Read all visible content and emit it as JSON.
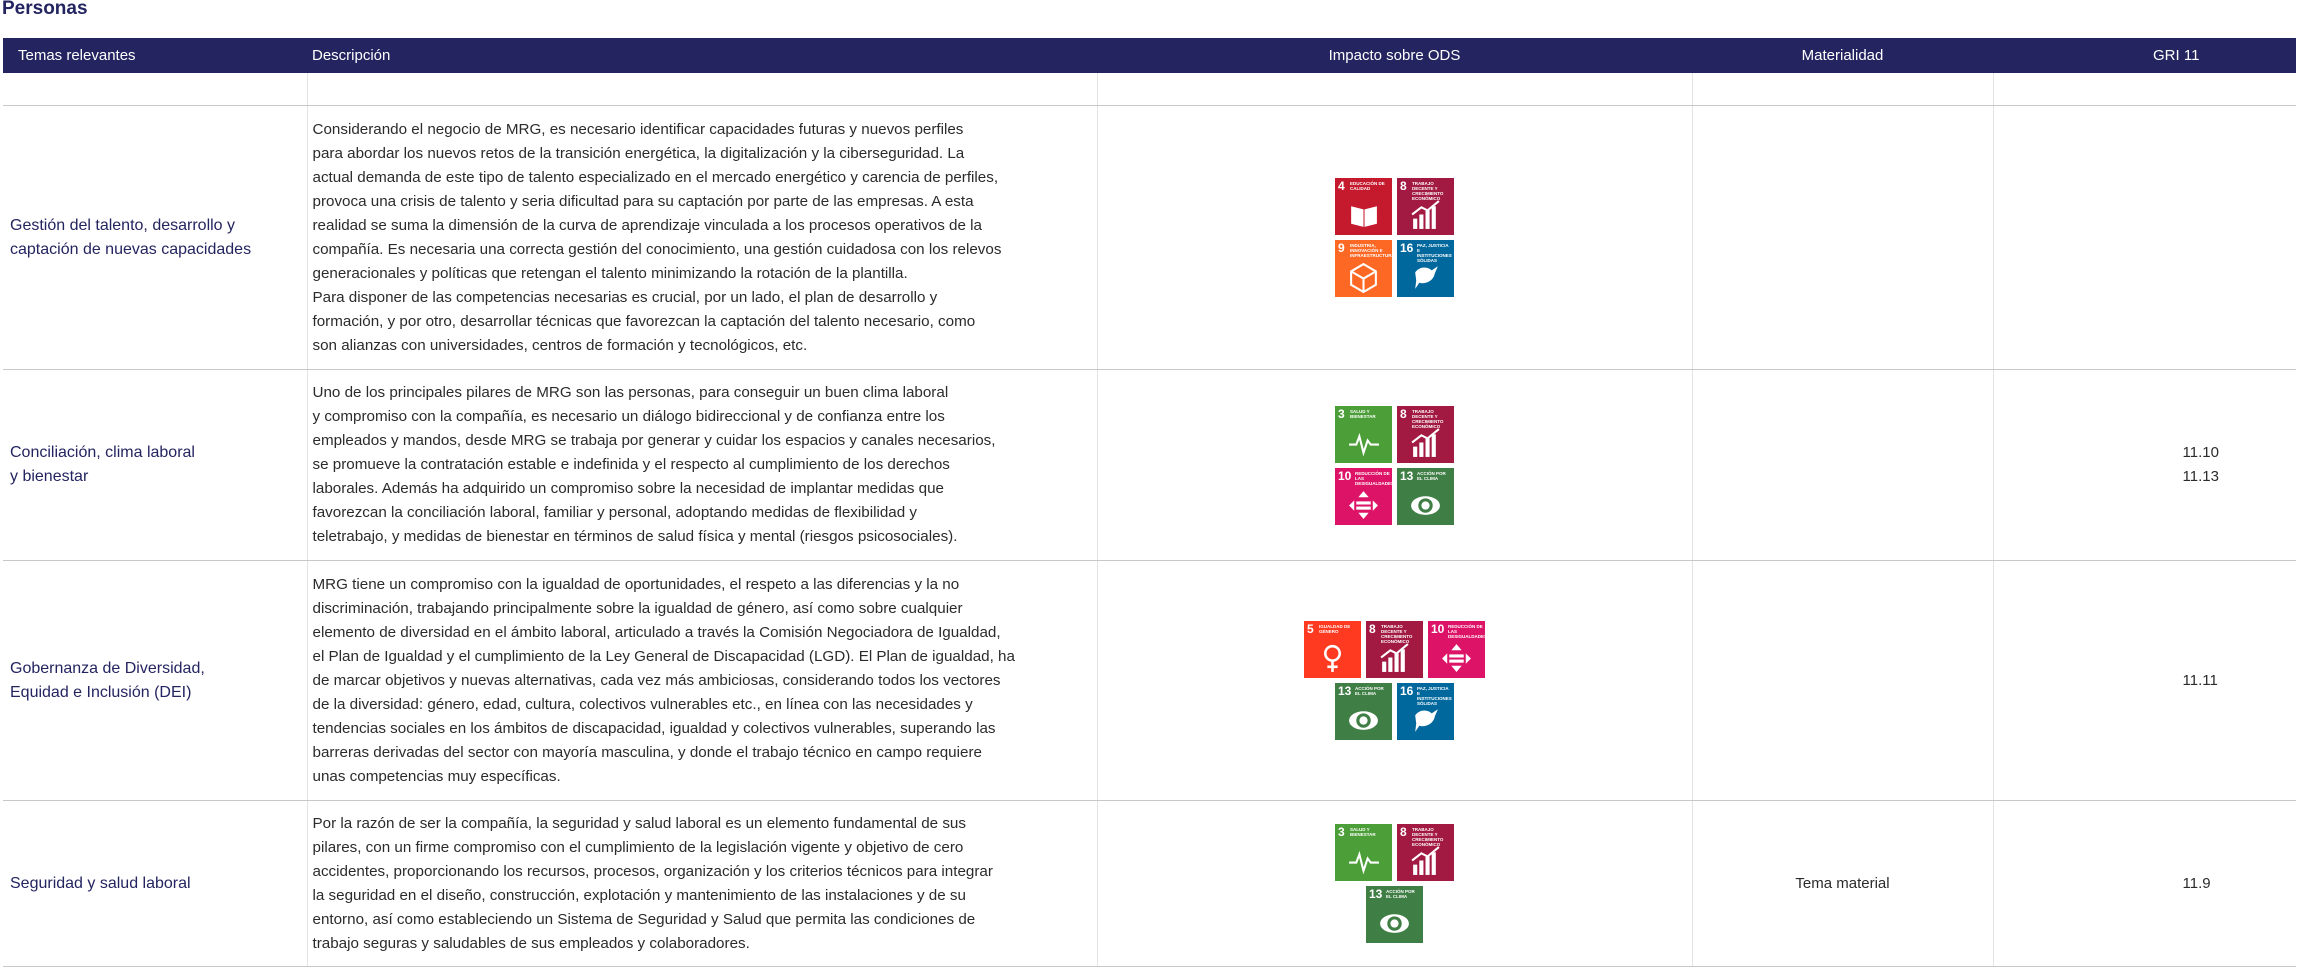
{
  "section_title": "Personas",
  "headers": {
    "topics": "Temas relevantes",
    "description": "Descripción",
    "sdg_impact": "Impacto sobre ODS",
    "materiality": "Materialidad",
    "gri": "GRI 11"
  },
  "sdg_colors": {
    "3": "#4c9f38",
    "4": "#c5192d",
    "5": "#ff3a21",
    "8": "#a21942",
    "9": "#fd6925",
    "10": "#dd1367",
    "13": "#3f7e44",
    "16": "#00689d"
  },
  "sdg_labels": {
    "3": "Salud y bienestar",
    "4": "Educación de calidad",
    "5": "Igualdad de género",
    "8": "Trabajo decente y crecimiento económico",
    "9": "Industria, innovación e infraestructura",
    "10": "Reducción de las desigualdades",
    "13": "Acción por el clima",
    "16": "Paz, justicia e instituciones sólidas"
  },
  "rows": [
    {
      "topic_line1": "Gestión del talento, desarrollo y",
      "topic_line2": "captación de nuevas capacidades",
      "desc_p1": "Considerando el negocio de MRG, es necesario identificar capacidades futuras y nuevos perfiles\npara abordar los nuevos retos de la transición energética, la digitalización y la ciberseguridad. La\nactual demanda de este tipo de talento especializado en el mercado energético y carencia de perfiles,\nprovoca una crisis de talento y seria dificultad para su captación por parte de las empresas. A esta\nrealidad se suma la dimensión de la curva de aprendizaje vinculada a los procesos operativos de la\ncompañía. Es necesaria una correcta gestión del conocimiento, una gestión cuidadosa con los relevos\ngeneracionales y políticas que retengan el talento minimizando la rotación de la plantilla.",
      "desc_p2": "Para disponer de las competencias necesarias es crucial, por un lado, el plan de desarrollo y\nformación, y por otro, desarrollar técnicas que favorezcan la captación del talento necesario, como\nson alianzas con universidades, centros de formación y tecnológicos, etc.",
      "sdg_rows": [
        [
          "4",
          "8"
        ],
        [
          "9",
          "16"
        ]
      ],
      "materiality": "",
      "gri": ""
    },
    {
      "topic_line1": "Conciliación, clima laboral",
      "topic_line2": "y bienestar",
      "desc_p1": "Uno de los principales pilares de MRG son las personas, para conseguir un buen clima laboral\ny compromiso con la compañía, es necesario un diálogo bidireccional y de confianza entre los\nempleados y mandos, desde MRG se trabaja por generar y cuidar los espacios y canales necesarios,\nse promueve la contratación estable e indefinida y el respecto al cumplimiento de los derechos\nlaborales. Además ha adquirido un compromiso sobre la necesidad de implantar medidas que\nfavorezcan la conciliación laboral, familiar y personal, adoptando medidas de flexibilidad y\nteletrabajo, y medidas de bienestar en términos de salud física y mental (riesgos psicosociales).",
      "desc_p2": "",
      "sdg_rows": [
        [
          "3",
          "8"
        ],
        [
          "10",
          "13"
        ]
      ],
      "materiality": "",
      "gri": "11.10\n11.13"
    },
    {
      "topic_line1": "Gobernanza de Diversidad,",
      "topic_line2": "Equidad e Inclusión (DEI)",
      "desc_p1": "MRG tiene un compromiso con la igualdad de oportunidades, el respeto a las diferencias y la no\ndiscriminación, trabajando principalmente sobre la igualdad de género, así como sobre cualquier\nelemento de diversidad en el ámbito laboral, articulado a través la Comisión Negociadora de Igualdad,\nel Plan de Igualdad y el cumplimiento de la Ley General de Discapacidad (LGD). El Plan de igualdad, ha\nde marcar objetivos y nuevas alternativas, cada vez más ambiciosas, considerando todos los vectores\nde la diversidad: género, edad, cultura, colectivos vulnerables etc., en línea con las necesidades y\ntendencias sociales en los ámbitos de discapacidad, igualdad y colectivos vulnerables, superando las\nbarreras derivadas del sector con mayoría masculina, y donde el trabajo técnico en campo requiere\nunas competencias muy específicas.",
      "desc_p2": "",
      "sdg_rows": [
        [
          "5",
          "8",
          "10"
        ],
        [
          "13",
          "16"
        ]
      ],
      "materiality": "",
      "gri": "11.11"
    },
    {
      "topic_line1": "Seguridad y salud laboral",
      "topic_line2": "",
      "desc_p1": "Por la razón de ser la compañía, la seguridad y salud laboral es un elemento fundamental de sus\npilares, con un firme compromiso con el cumplimiento de la legislación vigente y objetivo de cero\naccidentes, proporcionando los recursos, procesos, organización y los criterios técnicos para integrar\nla seguridad en el diseño, construcción, explotación y mantenimiento de las instalaciones y de su\nentorno, así como estableciendo un Sistema de Seguridad y Salud que permita las condiciones de\ntrabajo seguras y saludables de sus empleados y colaboradores.",
      "desc_p2": "",
      "sdg_rows": [
        [
          "3",
          "8"
        ],
        [
          "13"
        ]
      ],
      "materiality": "Tema material",
      "gri": "11.9"
    }
  ]
}
